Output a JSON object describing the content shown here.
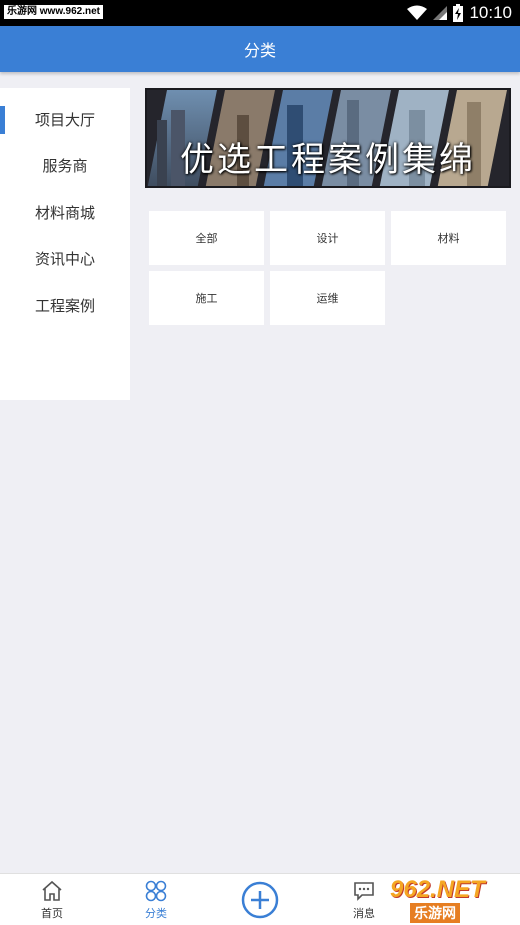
{
  "status_bar": {
    "watermark_text": "乐游网 www.962.net",
    "time": "10:10"
  },
  "header": {
    "title": "分类"
  },
  "sidebar": {
    "items": [
      {
        "label": "项目大厅",
        "active": true
      },
      {
        "label": "服务商",
        "active": false
      },
      {
        "label": "材料商城",
        "active": false
      },
      {
        "label": "资讯中心",
        "active": false
      },
      {
        "label": "工程案例",
        "active": false
      }
    ]
  },
  "banner": {
    "text": "优选工程案例集绵"
  },
  "categories": [
    {
      "label": "全部"
    },
    {
      "label": "设计"
    },
    {
      "label": "材料"
    },
    {
      "label": "施工"
    },
    {
      "label": "运维"
    }
  ],
  "bottom_nav": {
    "items": [
      {
        "label": "首页",
        "icon": "home-icon"
      },
      {
        "label": "分类",
        "icon": "category-icon",
        "active": true
      },
      {
        "label": "",
        "icon": "add-icon"
      },
      {
        "label": "消息",
        "icon": "message-icon"
      }
    ]
  },
  "watermark": {
    "top": "962.NET",
    "bottom": "乐游网"
  },
  "colors": {
    "accent": "#3a7fd5",
    "background": "#efeff4"
  }
}
